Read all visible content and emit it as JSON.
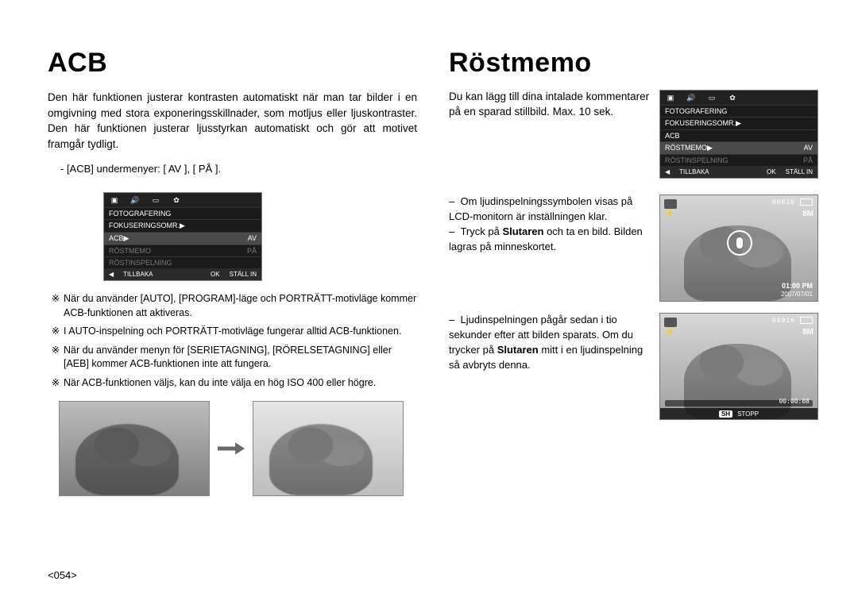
{
  "left": {
    "title": "ACB",
    "intro": "Den här funktionen justerar kontrasten automatiskt när man tar bilder i en omgivning med stora exponeringsskillnader, som motljus eller ljuskontraster. Den här funktionen justerar ljusstyrkan automatiskt och gör att motivet framgår tydligt.",
    "submenu_label": "- [ACB] undermenyer: [ AV ], [ PÅ ].",
    "lcd": {
      "rows": [
        {
          "label": "FOTOGRAFERING",
          "value": "",
          "key": "",
          "cls": ""
        },
        {
          "label": "FOKUSERINGSOMR.▶",
          "value": "",
          "key": "",
          "cls": ""
        },
        {
          "label": "ACB",
          "value": "AV",
          "key": "▶",
          "cls": "sel"
        },
        {
          "label": "RÖSTMEMO",
          "value": "PÅ",
          "key": "",
          "cls": "grey"
        },
        {
          "label": "RÖSTINSPELNING",
          "value": "",
          "key": "",
          "cls": "grey"
        }
      ],
      "footer_back": "TILLBAKA",
      "footer_ok": "OK",
      "footer_set": "STÄLL IN"
    },
    "notes": [
      "När du använder [AUTO], [PROGRAM]-läge och PORTRÄTT-motivläge kommer ACB-funktionen att aktiveras.",
      "I AUTO-inspelning och PORTRÄTT-motivläge fungerar alltid ACB-funktionen.",
      "När du använder menyn för [SERIETAGNING], [RÖRELSETAGNING] eller [AEB] kommer ACB-funktionen inte att fungera.",
      "När ACB-funktionen väljs, kan du inte välja en hög ISO 400 eller högre."
    ],
    "note_mark": "※"
  },
  "right": {
    "title": "Röstmemo",
    "intro": "Du kan lägg till dina intalade kommentarer på en sparad stillbild. Max. 10 sek.",
    "lcd": {
      "rows": [
        {
          "label": "FOTOGRAFERING",
          "value": "",
          "key": "",
          "cls": ""
        },
        {
          "label": "FOKUSERINGSOMR.▶",
          "value": "",
          "key": "",
          "cls": ""
        },
        {
          "label": "ACB",
          "value": "",
          "key": "",
          "cls": ""
        },
        {
          "label": "RÖSTMEMO",
          "value": "AV",
          "key": "▶",
          "cls": "sel"
        },
        {
          "label": "RÖSTINSPELNING",
          "value": "PÅ",
          "key": "",
          "cls": "grey"
        }
      ],
      "footer_back": "TILLBAKA",
      "footer_ok": "OK",
      "footer_set": "STÄLL IN"
    },
    "steps": [
      {
        "text_before": "Om ljudinspelningssymbolen visas på LCD-monitorn är inställningen klar.",
        "bold": "",
        "text_after": ""
      },
      {
        "text_before": "Tryck på ",
        "bold": "Slutaren",
        "text_after": " och ta en bild. Bilden lagras på minneskortet."
      },
      {
        "text_before": "Ljudinspelningen pågår sedan i tio sekunder efter att bilden sparats. Om du trycker på ",
        "bold": "Slutaren",
        "text_after": " mitt i en ljudinspelning så avbryts denna."
      }
    ],
    "preview1": {
      "counter": "00016",
      "mark8": "8M",
      "time": "01:00 PM",
      "date": "2007/07/01"
    },
    "preview2": {
      "counter": "00016",
      "mark8": "8M",
      "rectime": "00:00:08",
      "stop_sh": "SH",
      "stop_label": "STOPP"
    }
  },
  "page_number": "<054>"
}
